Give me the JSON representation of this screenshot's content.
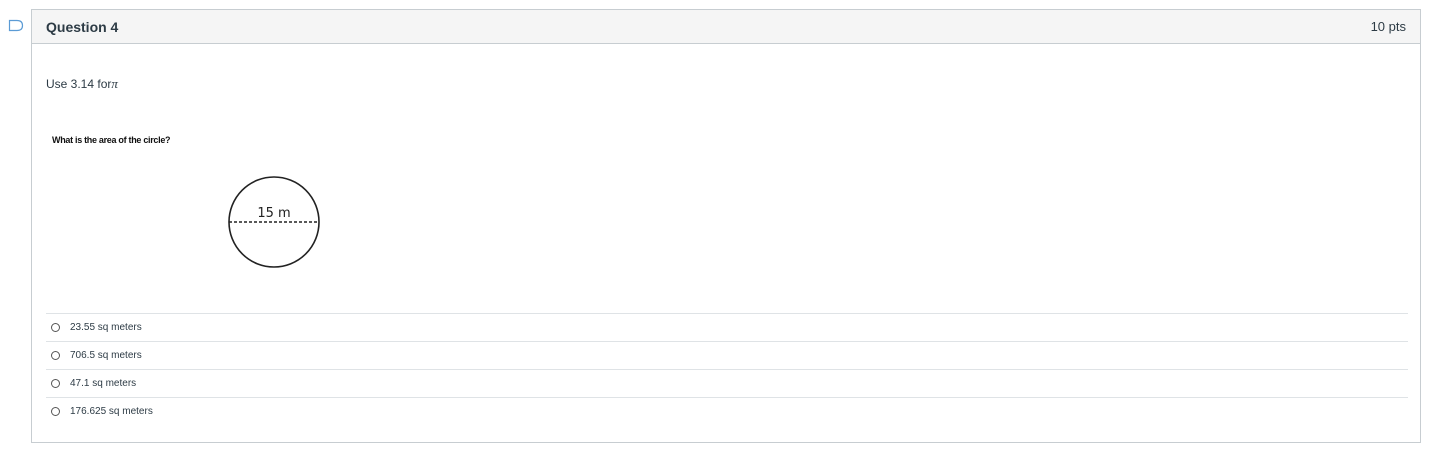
{
  "question": {
    "title": "Question 4",
    "points": "10 pts",
    "prompt_prefix": "Use 3.14 for",
    "prompt_symbol": "π",
    "figure": {
      "caption": "What is the area of the circle?",
      "diameter_label": "15 m"
    },
    "answers": [
      {
        "label": "23.55 sq meters",
        "selected": false
      },
      {
        "label": "706.5 sq meters",
        "selected": false
      },
      {
        "label": "47.1 sq meters",
        "selected": false
      },
      {
        "label": "176.625 sq meters",
        "selected": false
      }
    ]
  },
  "colors": {
    "header_bg": "#f5f5f5",
    "border": "#c7cdd1",
    "flag_outline": "#5b9bd5",
    "text": "#2d3b45"
  },
  "icons": {
    "flag": "flag-outline-icon",
    "radio": "radio-unchecked-icon"
  }
}
